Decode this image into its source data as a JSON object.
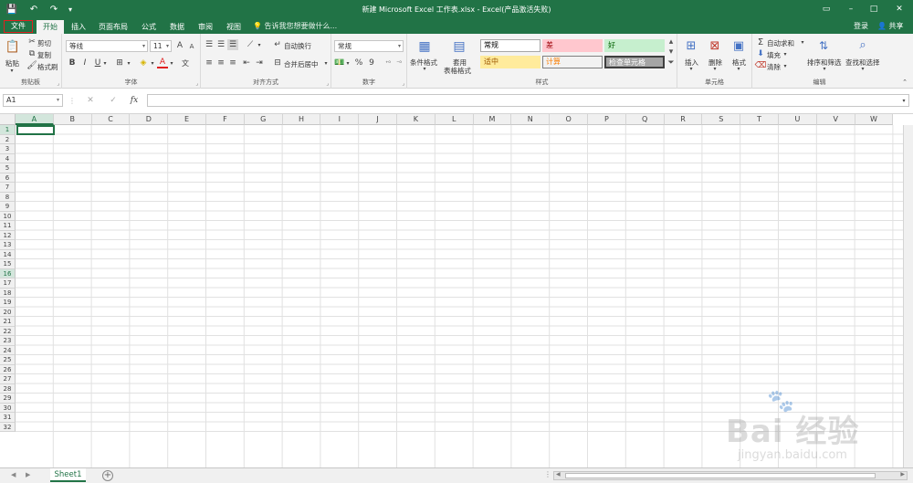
{
  "window": {
    "title": "新建 Microsoft Excel 工作表.xlsx - Excel(产品激活失败)",
    "controls": [
      "–",
      "□",
      "✕"
    ],
    "ribbon_options_glyph": "▭"
  },
  "quick_access": {
    "save_glyph": "💾",
    "undo_glyph": "↶",
    "redo_glyph": "↷",
    "customize_glyph": "▾"
  },
  "tabs": [
    {
      "label": "文件"
    },
    {
      "label": "开始"
    },
    {
      "label": "插入"
    },
    {
      "label": "页面布局"
    },
    {
      "label": "公式"
    },
    {
      "label": "数据"
    },
    {
      "label": "审阅"
    },
    {
      "label": "视图"
    }
  ],
  "tell_me": "告诉我您想要做什么...",
  "account": {
    "login": "登录",
    "share": "共享"
  },
  "ribbon": {
    "clipboard": {
      "label": "剪贴板",
      "paste": "粘贴",
      "cut": "剪切",
      "copy": "复制",
      "format_painter": "格式刷"
    },
    "font": {
      "label": "字体",
      "font_name": "等线",
      "font_size": "11",
      "grow": "A",
      "shrink": "A",
      "bold": "B",
      "italic": "I",
      "underline": "U",
      "font_color_glyph": "A",
      "phonetic_glyph": "文"
    },
    "alignment": {
      "label": "对齐方式",
      "wrap_text": "自动换行",
      "merge_center": "合并后居中"
    },
    "number": {
      "label": "数字",
      "format": "常规",
      "percent": "%",
      "comma": "9"
    },
    "styles": {
      "label": "样式",
      "conditional": "条件格式",
      "table_format_1": "套用",
      "table_format_2": "表格格式",
      "cells": [
        {
          "name": "常规",
          "bg": "#ffffff",
          "fg": "#000000",
          "border": "#a6a6a6"
        },
        {
          "name": "差",
          "bg": "#ffc7ce",
          "fg": "#9c0006",
          "border": "#ffc7ce"
        },
        {
          "name": "好",
          "bg": "#c6efce",
          "fg": "#006100",
          "border": "#c6efce"
        },
        {
          "name": "适中",
          "bg": "#ffeb9c",
          "fg": "#9c5700",
          "border": "#ffeb9c"
        },
        {
          "name": "计算",
          "bg": "#f2f2f2",
          "fg": "#fa7d00",
          "border": "#7f7f7f"
        },
        {
          "name": "检查单元格",
          "bg": "#a5a5a5",
          "fg": "#ffffff",
          "border": "#3f3f3f"
        }
      ]
    },
    "cells": {
      "label": "单元格",
      "insert": "插入",
      "delete": "删除",
      "format": "格式"
    },
    "editing": {
      "label": "编辑",
      "autosum": "自动求和",
      "fill": "填充",
      "clear": "清除",
      "sort_filter": "排序和筛选",
      "find_select": "查找和选择"
    }
  },
  "formula_bar": {
    "name_box": "A1",
    "cancel_glyph": "✕",
    "enter_glyph": "✓",
    "fx_glyph": "fx",
    "value": ""
  },
  "grid": {
    "columns": [
      "A",
      "B",
      "C",
      "D",
      "E",
      "F",
      "G",
      "H",
      "I",
      "J",
      "K",
      "L",
      "M",
      "N",
      "O",
      "P",
      "Q",
      "R",
      "S",
      "T",
      "U",
      "V",
      "W"
    ],
    "rows": [
      "1",
      "2",
      "3",
      "4",
      "5",
      "6",
      "7",
      "8",
      "9",
      "10",
      "11",
      "12",
      "13",
      "14",
      "15",
      "16",
      "17",
      "18",
      "19",
      "20",
      "21",
      "22",
      "23",
      "24",
      "25",
      "26",
      "27",
      "28",
      "29",
      "30",
      "31",
      "32"
    ],
    "active_cell": "A1",
    "highlighted_row": "16"
  },
  "sheets": [
    {
      "name": "Sheet1",
      "active": true
    }
  ],
  "add_sheet_glyph": "+",
  "watermark": {
    "brand": "Bai 经验",
    "url": "jingyan.baidu.com"
  },
  "colors": {
    "accent": "#217346",
    "file_tab_outline": "#e02020"
  }
}
